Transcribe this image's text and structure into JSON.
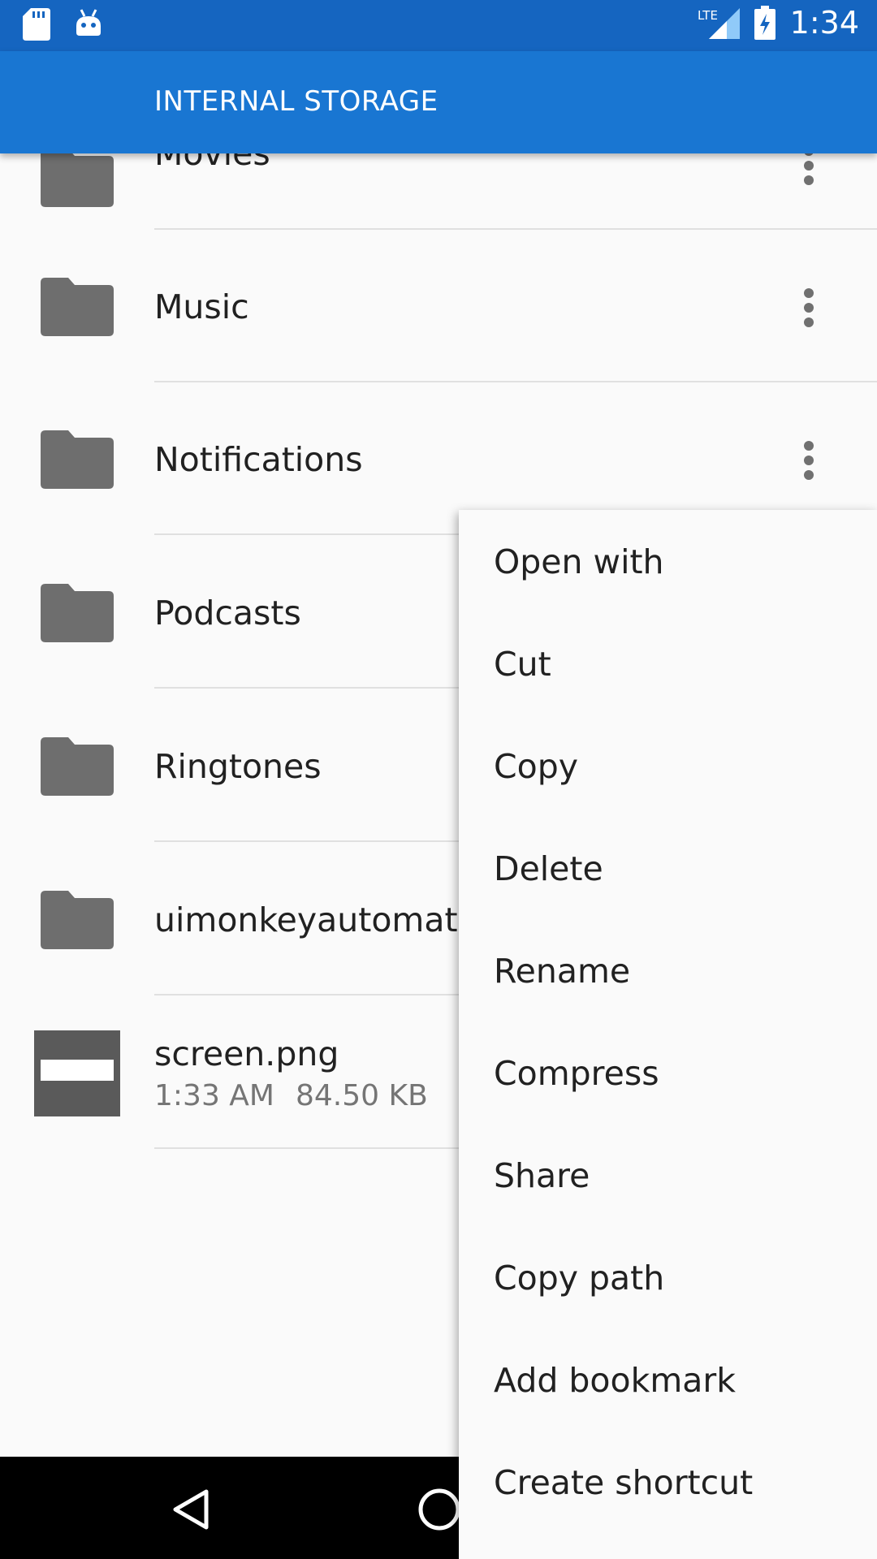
{
  "status_bar": {
    "time": "1:34",
    "network": "LTE",
    "icons": [
      "sd-card-icon",
      "android-icon",
      "signal-icon",
      "battery-charging-icon"
    ]
  },
  "toolbar": {
    "title": "INTERNAL STORAGE"
  },
  "list": {
    "folders": [
      {
        "name": "Movies"
      },
      {
        "name": "Music"
      },
      {
        "name": "Notifications"
      },
      {
        "name": "Podcasts"
      },
      {
        "name": "Ringtones"
      },
      {
        "name": "uimonkeyautomator"
      }
    ],
    "file": {
      "name": "screen.png",
      "time": "1:33 AM",
      "size": "84.50 KB"
    }
  },
  "menu": {
    "items": [
      "Open with",
      "Cut",
      "Copy",
      "Delete",
      "Rename",
      "Compress",
      "Share",
      "Copy path",
      "Add bookmark",
      "Create shortcut"
    ]
  },
  "colors": {
    "status_bar": "#1565c0",
    "toolbar": "#1976d2",
    "folder_icon": "#6e6e6e"
  }
}
